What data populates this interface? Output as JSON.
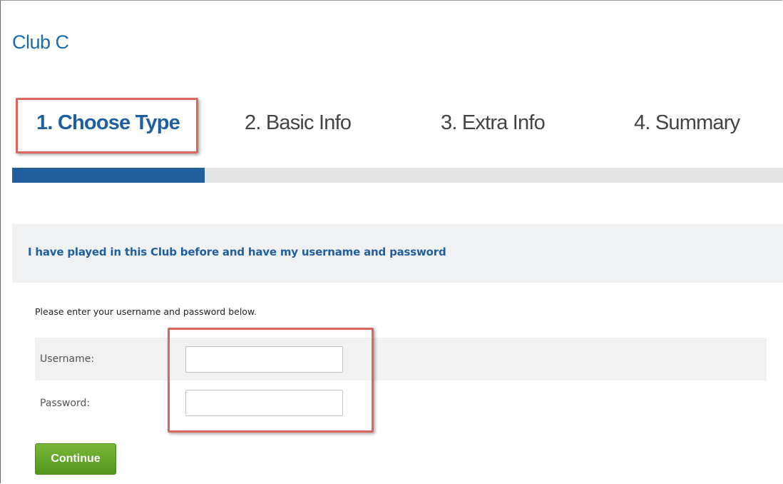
{
  "header": {
    "club_title": "Club C"
  },
  "steps": [
    {
      "label": "1. Choose Type",
      "active": true
    },
    {
      "label": "2. Basic Info",
      "active": false
    },
    {
      "label": "3. Extra Info",
      "active": false
    },
    {
      "label": "4. Summary",
      "active": false
    }
  ],
  "progress": {
    "fraction_complete": 0.25
  },
  "section": {
    "heading": "I have played in this Club before and have my username and password"
  },
  "login_form": {
    "instructions": "Please enter your username and password below.",
    "username_label": "Username:",
    "username_value": "",
    "password_label": "Password:",
    "password_value": "",
    "continue_label": "Continue"
  },
  "colors": {
    "brand_blue": "#1f5f9e",
    "continue_green": "#5fa129",
    "highlight_red": "#d9675f"
  }
}
